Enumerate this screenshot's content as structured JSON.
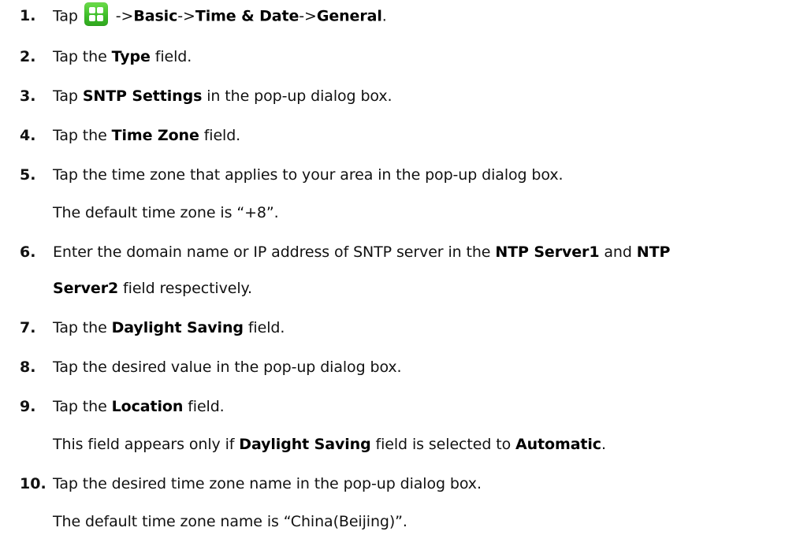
{
  "steps": [
    {
      "num": "1.",
      "parts": [
        "Tap",
        "->",
        "Basic",
        "->",
        "Time & Date",
        "->",
        "General",
        "."
      ]
    },
    {
      "num": "2.",
      "parts": [
        "Tap the ",
        "Type",
        " field."
      ]
    },
    {
      "num": "3.",
      "parts": [
        "Tap ",
        "SNTP Settings",
        " in the pop-up dialog box."
      ]
    },
    {
      "num": "4.",
      "parts": [
        "Tap the ",
        "Time Zone",
        " field."
      ]
    },
    {
      "num": "5.",
      "parts": [
        "Tap the time zone that applies to your area in the pop-up dialog box."
      ]
    },
    {
      "num": "6.",
      "parts": [
        "Enter the domain name or IP address of SNTP server in the ",
        "NTP Server1",
        " and ",
        "NTP",
        "Server2",
        " field respectively."
      ]
    },
    {
      "num": "7.",
      "parts": [
        "Tap the ",
        "Daylight Saving",
        " field."
      ]
    },
    {
      "num": "8.",
      "parts": [
        "Tap the desired value in the pop-up dialog box."
      ]
    },
    {
      "num": "9.",
      "parts": [
        "Tap the ",
        "Location",
        " field."
      ]
    },
    {
      "num": "10.",
      "parts": [
        "Tap the desired time zone name in the pop-up dialog box."
      ]
    }
  ],
  "notes": {
    "step5": "The default time zone is “+8”.",
    "step9": [
      "This field appears only if ",
      "Daylight Saving",
      " field is selected to ",
      "Automatic",
      "."
    ],
    "step10": "The default time zone name is “China(Beijing)”."
  },
  "icons": {
    "menu_icon": "green-grid-menu-icon"
  },
  "colors": {
    "icon_green": "#3fbf2a",
    "text": "#111111"
  }
}
